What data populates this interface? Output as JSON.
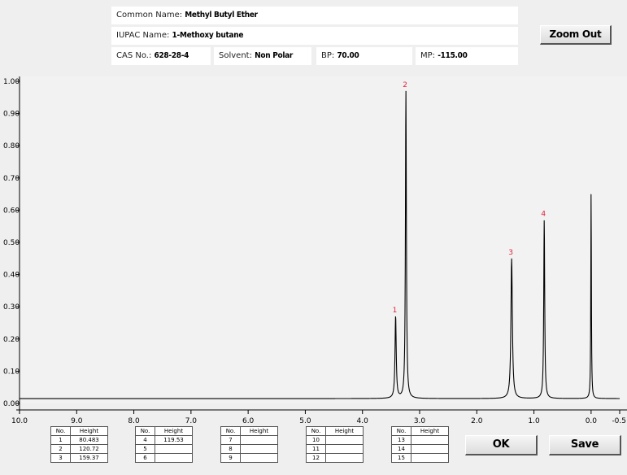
{
  "info": {
    "common_name_label": "Common Name:",
    "common_name": "Methyl Butyl Ether",
    "iupac_label": "IUPAC Name:",
    "iupac_name": "1-Methoxy butane",
    "cas_label": "CAS No.:",
    "cas": "628-28-4",
    "solvent_label": "Solvent:",
    "solvent": "Non Polar",
    "bp_label": "BP:",
    "bp": "70.00",
    "mp_label": "MP:",
    "mp": "-115.00"
  },
  "buttons": {
    "zoom_out": "Zoom Out",
    "ok": "OK",
    "save": "Save"
  },
  "colors": {
    "background": "#efefef",
    "trace": "#000000",
    "peak_label": "#e0203a",
    "panel": "#ffffff"
  },
  "chart_data": {
    "type": "line",
    "x_ticks": [
      "10.0",
      "9.0",
      "8.0",
      "7.0",
      "6.0",
      "5.0",
      "4.0",
      "3.0",
      "2.0",
      "1.0",
      "0.0",
      "-0.5"
    ],
    "y_ticks": [
      "1.00",
      "0.90",
      "0.80",
      "0.70",
      "0.60",
      "0.50",
      "0.40",
      "0.30",
      "0.20",
      "0.10",
      "0.00"
    ],
    "xlim": [
      10.0,
      -0.5
    ],
    "ylim": [
      0.0,
      1.0
    ],
    "baseline": 0.015,
    "peaks": [
      {
        "label": "1",
        "shift": 3.42,
        "height": 0.27,
        "width": 0.025
      },
      {
        "label": "2",
        "shift": 3.24,
        "height": 0.97,
        "width": 0.02
      },
      {
        "label": "3",
        "shift": 1.39,
        "height": 0.45,
        "width": 0.03
      },
      {
        "label": "4",
        "shift": 0.82,
        "height": 0.57,
        "width": 0.02
      },
      {
        "label": "",
        "shift": 0.0,
        "height": 0.66,
        "width": 0.012
      }
    ]
  },
  "peak_table": {
    "col_no": "No.",
    "col_height": "Height",
    "rows": [
      {
        "no": "1",
        "height": "80.483"
      },
      {
        "no": "2",
        "height": "120.72"
      },
      {
        "no": "3",
        "height": "159.37"
      },
      {
        "no": "4",
        "height": "119.53"
      },
      {
        "no": "5",
        "height": ""
      },
      {
        "no": "6",
        "height": ""
      },
      {
        "no": "7",
        "height": ""
      },
      {
        "no": "8",
        "height": ""
      },
      {
        "no": "9",
        "height": ""
      },
      {
        "no": "10",
        "height": ""
      },
      {
        "no": "11",
        "height": ""
      },
      {
        "no": "12",
        "height": ""
      },
      {
        "no": "13",
        "height": ""
      },
      {
        "no": "14",
        "height": ""
      },
      {
        "no": "15",
        "height": ""
      }
    ]
  }
}
